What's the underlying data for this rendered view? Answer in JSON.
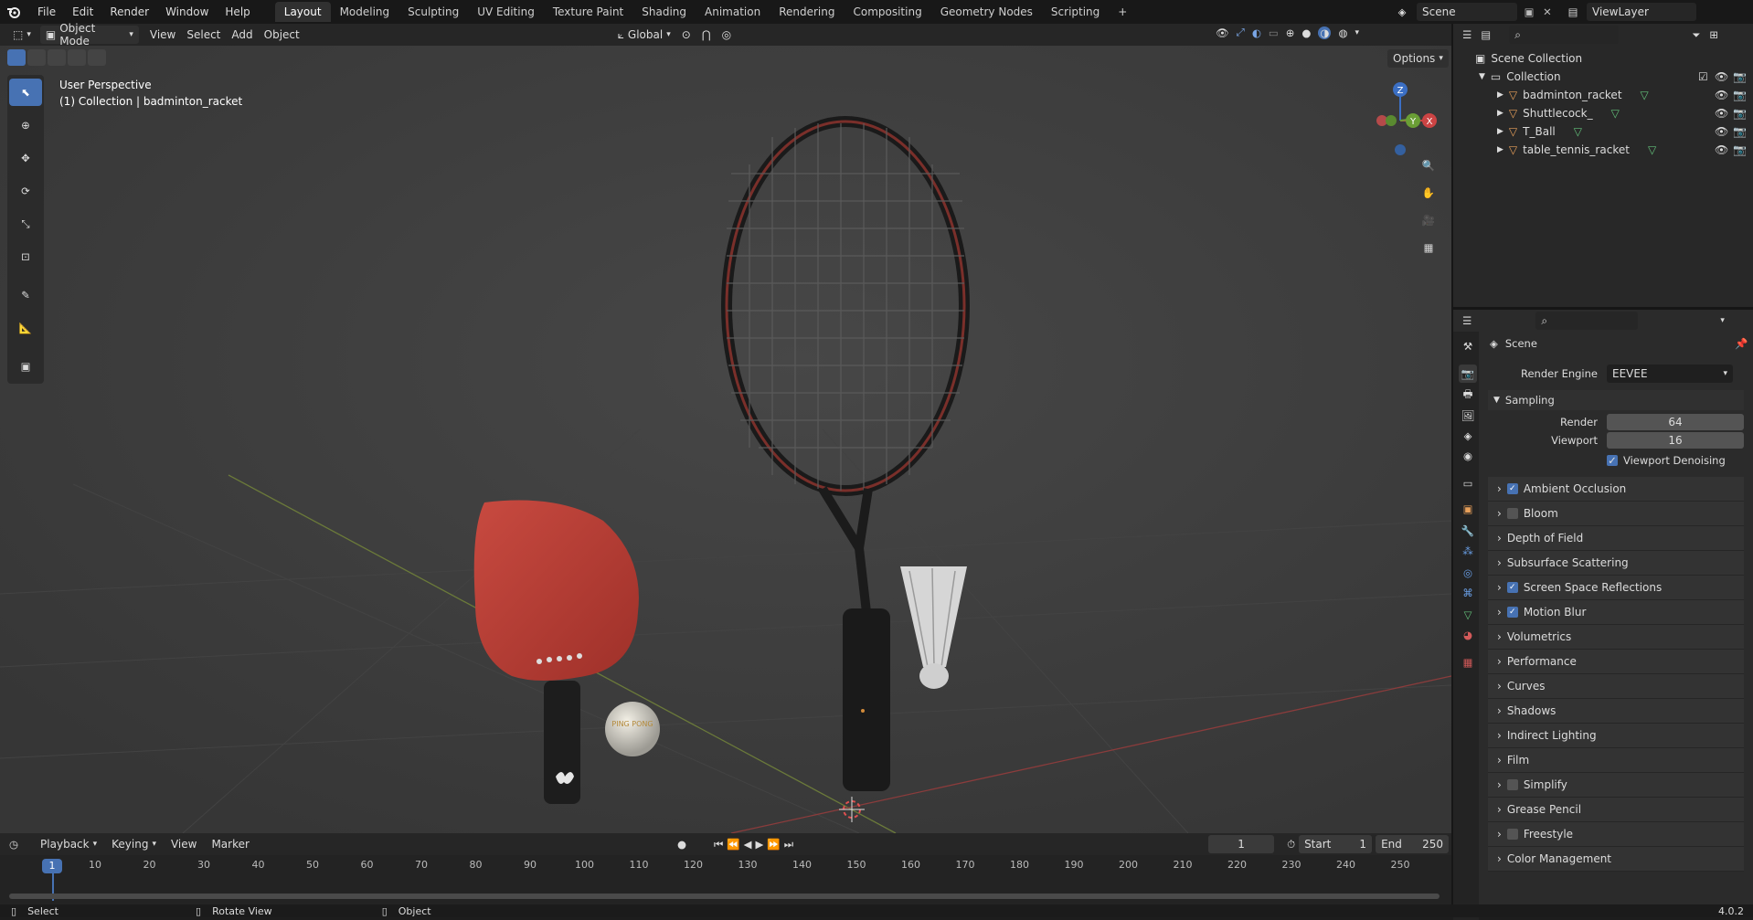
{
  "menu": [
    "File",
    "Edit",
    "Render",
    "Window",
    "Help"
  ],
  "workspaces": [
    "Layout",
    "Modeling",
    "Sculpting",
    "UV Editing",
    "Texture Paint",
    "Shading",
    "Animation",
    "Rendering",
    "Compositing",
    "Geometry Nodes",
    "Scripting"
  ],
  "scene": "Scene",
  "view_layer": "ViewLayer",
  "header": {
    "mode": "Object Mode",
    "view": "View",
    "select": "Select",
    "add": "Add",
    "object": "Object",
    "orientation": "Global",
    "options": "Options"
  },
  "viewport": {
    "title": "User Perspective",
    "subtitle": "(1) Collection | badminton_racket",
    "ball_text": "PING PONG"
  },
  "axes": {
    "x": "X",
    "y": "Y",
    "z": "Z"
  },
  "outliner": {
    "root": "Scene Collection",
    "collection": "Collection",
    "objects": [
      "badminton_racket",
      "Shuttlecock_",
      "T_Ball",
      "table_tennis_racket"
    ]
  },
  "properties": {
    "scene": "Scene",
    "render_engine_label": "Render Engine",
    "render_engine": "EEVEE",
    "sampling": "Sampling",
    "render_label": "Render",
    "render_value": "64",
    "viewport_label": "Viewport",
    "viewport_value": "16",
    "denoise": "Viewport Denoising",
    "panels": [
      {
        "label": "Ambient Occlusion",
        "check": "on"
      },
      {
        "label": "Bloom",
        "check": "off"
      },
      {
        "label": "Depth of Field",
        "check": "none"
      },
      {
        "label": "Subsurface Scattering",
        "check": "none"
      },
      {
        "label": "Screen Space Reflections",
        "check": "on"
      },
      {
        "label": "Motion Blur",
        "check": "on"
      },
      {
        "label": "Volumetrics",
        "check": "none"
      },
      {
        "label": "Performance",
        "check": "none"
      },
      {
        "label": "Curves",
        "check": "none"
      },
      {
        "label": "Shadows",
        "check": "none"
      },
      {
        "label": "Indirect Lighting",
        "check": "none"
      },
      {
        "label": "Film",
        "check": "none"
      },
      {
        "label": "Simplify",
        "check": "off"
      },
      {
        "label": "Grease Pencil",
        "check": "none"
      },
      {
        "label": "Freestyle",
        "check": "off"
      },
      {
        "label": "Color Management",
        "check": "none"
      }
    ]
  },
  "timeline": {
    "playback": "Playback",
    "keying": "Keying",
    "view": "View",
    "marker": "Marker",
    "current": "1",
    "start_label": "Start",
    "start": "1",
    "end_label": "End",
    "end": "250",
    "ticks": [
      "10",
      "20",
      "30",
      "40",
      "50",
      "60",
      "70",
      "80",
      "90",
      "100",
      "110",
      "120",
      "130",
      "140",
      "150",
      "160",
      "170",
      "180",
      "190",
      "200",
      "210",
      "220",
      "230",
      "240",
      "250"
    ],
    "frame_marker": "1"
  },
  "status": {
    "select": "Select",
    "rotate": "Rotate View",
    "object": "Object",
    "version": "4.0.2"
  }
}
